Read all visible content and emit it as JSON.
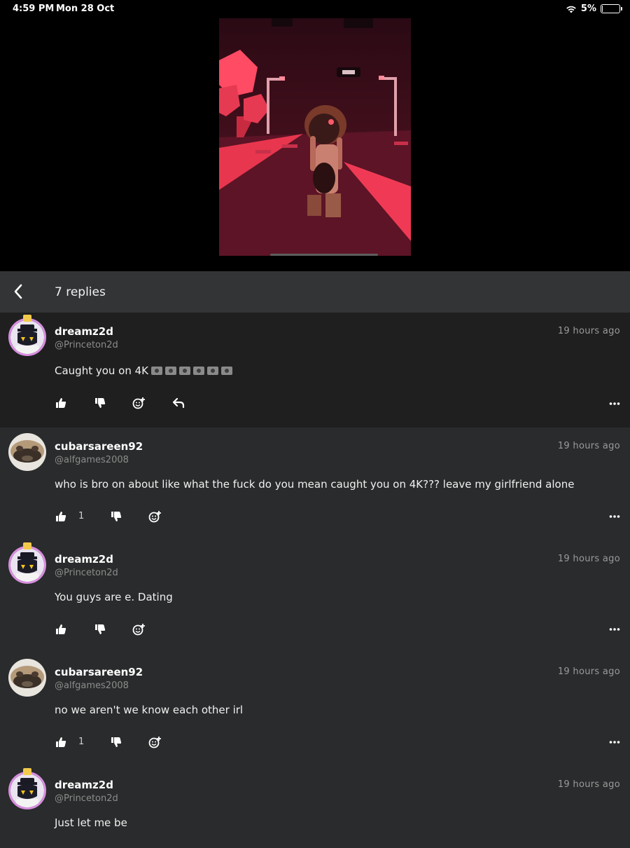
{
  "status_bar": {
    "time": "4:59 PM",
    "date": "Mon 28 Oct",
    "battery": "5%",
    "battery_level": 0.05
  },
  "header": {
    "title": "7 replies"
  },
  "comments": [
    {
      "username": "dreamz2d",
      "handle": "@Princeton2d",
      "time": "19 hours ago",
      "text": "Caught you on 4K",
      "emoji_suffix": [
        "camera-with-flash",
        "camera-with-flash",
        "camera-with-flash",
        "camera-with-flash",
        "camera-with-flash",
        "camera-with-flash"
      ],
      "likes": "",
      "avatar": "robot-avatar",
      "has_reply_button": true
    },
    {
      "username": "cubarsareen92",
      "handle": "@alfgames2008",
      "time": "19 hours ago",
      "text": "who is bro on about like what the fuck do you mean caught you on 4K??? leave my girlfriend alone",
      "likes": "1",
      "avatar": "pug-avatar",
      "has_reply_button": false
    },
    {
      "username": "dreamz2d",
      "handle": "@Princeton2d",
      "time": "19 hours ago",
      "text": "You guys are e. Dating",
      "likes": "",
      "avatar": "robot-avatar",
      "has_reply_button": false
    },
    {
      "username": "cubarsareen92",
      "handle": "@alfgames2008",
      "time": "19 hours ago",
      "text": "no we aren't we know each other irl",
      "likes": "1",
      "avatar": "pug-avatar",
      "has_reply_button": false
    },
    {
      "username": "dreamz2d",
      "handle": "@Princeton2d",
      "time": "19 hours ago",
      "text": "Just let me be",
      "likes": "",
      "avatar": "robot-avatar",
      "has_reply_button": false
    }
  ],
  "colors": {
    "background": "#2a2b2c",
    "highlight": "#1f1f20",
    "header": "#333435",
    "avatar_ring": "#d98ee0"
  }
}
